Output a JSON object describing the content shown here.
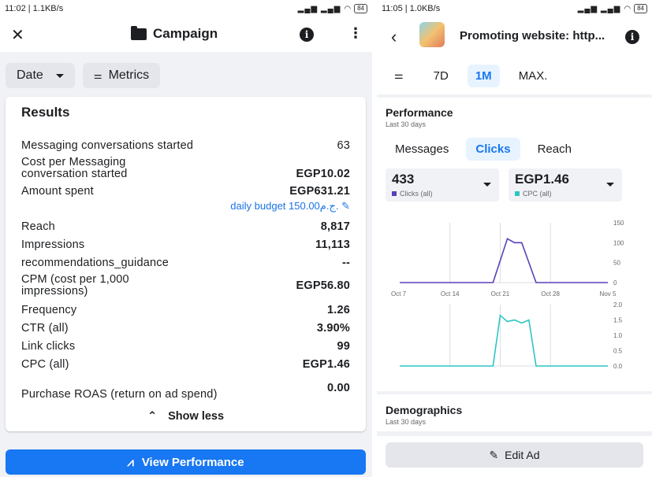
{
  "left": {
    "status": {
      "time": "11:02 | 1.1KB/s",
      "battery": "84"
    },
    "header": {
      "title": "Campaign"
    },
    "filters": {
      "date": "Date",
      "metrics": "Metrics"
    },
    "results": {
      "title": "Results",
      "rows": [
        {
          "label": "Messaging conversations started",
          "value": "63"
        },
        {
          "label": "Cost per Messaging conversation started",
          "value": "EGP10.02"
        },
        {
          "label": "Amount spent",
          "value": "EGP631.21"
        },
        {
          "label": "Reach",
          "value": "8,817"
        },
        {
          "label": "Impressions",
          "value": "11,113"
        },
        {
          "label": "recommendations_guidance",
          "value": "--"
        },
        {
          "label": "CPM (cost per 1,000 impressions)",
          "value": "EGP56.80"
        },
        {
          "label": "Frequency",
          "value": "1.26"
        },
        {
          "label": "CTR (all)",
          "value": "3.90%"
        },
        {
          "label": "Link clicks",
          "value": "99"
        },
        {
          "label": "CPC (all)",
          "value": "EGP1.46"
        },
        {
          "label": "Purchase ROAS (return on ad spend)",
          "value": "0.00"
        }
      ],
      "budget": "daily budget 150.00ج.م.",
      "show_less": "Show less"
    },
    "view_performance": "View Performance"
  },
  "right": {
    "status": {
      "time": "11:05 | 1.0KB/s",
      "battery": "84"
    },
    "header": {
      "title": "Promoting website: http..."
    },
    "ranges": [
      {
        "label": "7D"
      },
      {
        "label": "1M",
        "active": true
      },
      {
        "label": "MAX."
      }
    ],
    "performance": {
      "title": "Performance",
      "subtitle": "Last 30 days",
      "tabs": [
        {
          "label": "Messages"
        },
        {
          "label": "Clicks",
          "active": true
        },
        {
          "label": "Reach"
        }
      ],
      "metric1": {
        "value": "433",
        "label": "Clicks (all)",
        "color": "#5b3fb8"
      },
      "metric2": {
        "value": "EGP1.46",
        "label": "CPC (all)",
        "color": "#2ec4c4"
      }
    },
    "demographics": {
      "title": "Demographics",
      "subtitle": "Last 30 days"
    },
    "edit_ad": "Edit Ad"
  },
  "chart_data": [
    {
      "type": "line",
      "x": [
        "Oct 7",
        "Oct 8",
        "Oct 9",
        "Oct 10",
        "Oct 11",
        "Oct 12",
        "Oct 13",
        "Oct 14",
        "Oct 15",
        "Oct 16",
        "Oct 17",
        "Oct 18",
        "Oct 19",
        "Oct 20",
        "Oct 21",
        "Oct 22",
        "Oct 23",
        "Oct 24",
        "Oct 25",
        "Oct 26",
        "Oct 27",
        "Oct 28",
        "Oct 29",
        "Oct 30",
        "Oct 31",
        "Nov 1",
        "Nov 2",
        "Nov 3",
        "Nov 4",
        "Nov 5"
      ],
      "xticks": [
        "Oct 7",
        "Oct 14",
        "Oct 21",
        "Oct 28",
        "Nov 5"
      ],
      "series": [
        {
          "name": "Clicks (all)",
          "color": "#5b3fb8",
          "values": [
            0,
            0,
            0,
            0,
            0,
            0,
            0,
            0,
            0,
            0,
            0,
            0,
            0,
            0,
            55,
            110,
            100,
            100,
            50,
            0,
            0,
            0,
            0,
            0,
            0,
            0,
            0,
            0,
            0,
            0
          ]
        }
      ],
      "ylim": [
        0,
        150
      ],
      "yticks": [
        "150",
        "100",
        "50",
        "0"
      ]
    },
    {
      "type": "line",
      "x": [
        "Oct 7",
        "Oct 8",
        "Oct 9",
        "Oct 10",
        "Oct 11",
        "Oct 12",
        "Oct 13",
        "Oct 14",
        "Oct 15",
        "Oct 16",
        "Oct 17",
        "Oct 18",
        "Oct 19",
        "Oct 20",
        "Oct 21",
        "Oct 22",
        "Oct 23",
        "Oct 24",
        "Oct 25",
        "Oct 26",
        "Oct 27",
        "Oct 28",
        "Oct 29",
        "Oct 30",
        "Oct 31",
        "Nov 1",
        "Nov 2",
        "Nov 3",
        "Nov 4",
        "Nov 5"
      ],
      "series": [
        {
          "name": "CPC (all)",
          "color": "#2ec4c4",
          "values": [
            0,
            0,
            0,
            0,
            0,
            0,
            0,
            0,
            0,
            0,
            0,
            0,
            0,
            0,
            1.65,
            1.45,
            1.5,
            1.4,
            1.5,
            0,
            0,
            0,
            0,
            0,
            0,
            0,
            0,
            0,
            0,
            0
          ]
        }
      ],
      "ylim": [
        0,
        2.0
      ],
      "yticks": [
        "2.0",
        "1.5",
        "1.0",
        "0.5",
        "0.0"
      ]
    }
  ]
}
